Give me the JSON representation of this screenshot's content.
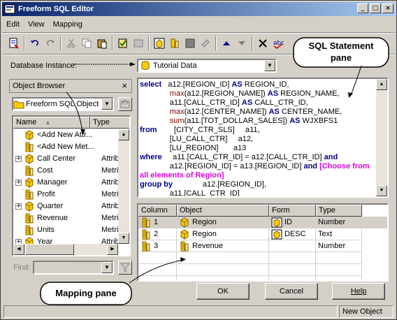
{
  "window": {
    "title": "Freeform SQL Editor",
    "minimize_glyph": "_",
    "maximize_glyph": "□",
    "close_glyph": "×"
  },
  "menu": [
    "Edit",
    "View",
    "Mapping"
  ],
  "toolbar_icons": [
    "sql-icon",
    "undo-icon",
    "redo-icon",
    "cut-icon",
    "copy-icon",
    "paste-icon",
    "validate-icon",
    "parse-icon",
    "attribute-icon",
    "metric-icon",
    "map-icon",
    "link-icon",
    "move-up-icon",
    "move-down-icon",
    "delete-icon",
    "spell-check-icon"
  ],
  "database_instance": {
    "label": "Database Instance:",
    "value": "Tutorial Data"
  },
  "object_browser": {
    "title": "Object Browser",
    "close_glyph": "×",
    "folder": "Freeform SQL Object",
    "columns": {
      "name": "Name",
      "type": "Type"
    },
    "rows": [
      {
        "name": "<Add New Attr...",
        "type": "",
        "icon": "attribute",
        "expand": false
      },
      {
        "name": "<Add New Met...",
        "type": "",
        "icon": "metric",
        "expand": false
      },
      {
        "name": "Call Center",
        "type": "Attribute",
        "icon": "attribute",
        "expand": true
      },
      {
        "name": "Cost",
        "type": "Metric",
        "icon": "metric",
        "expand": false
      },
      {
        "name": "Manager",
        "type": "Attribute",
        "icon": "attribute",
        "expand": true
      },
      {
        "name": "Profit",
        "type": "Metric",
        "icon": "metric",
        "expand": false
      },
      {
        "name": "Quarter",
        "type": "Attribute",
        "icon": "attribute",
        "expand": true
      },
      {
        "name": "Revenue",
        "type": "Metric",
        "icon": "metric",
        "expand": false
      },
      {
        "name": "Units",
        "type": "Metric",
        "icon": "metric",
        "expand": false
      },
      {
        "name": "Year",
        "type": "Attribute",
        "icon": "attribute",
        "expand": true
      }
    ],
    "find_label": "Find:"
  },
  "sql": [
    [
      {
        "c": "kw",
        "t": "select"
      },
      {
        "c": "",
        "t": "   a12.[REGION_ID] "
      },
      {
        "c": "kw",
        "t": "AS"
      },
      {
        "c": "",
        "t": " REGION_ID,"
      }
    ],
    [
      {
        "c": "",
        "t": "              "
      },
      {
        "c": "br",
        "t": "max"
      },
      {
        "c": "",
        "t": "(a12.[REGION_NAME]) "
      },
      {
        "c": "kw",
        "t": "AS"
      },
      {
        "c": "",
        "t": " REGION_NAME,"
      }
    ],
    [
      {
        "c": "",
        "t": "              a11.[CALL_CTR_ID] "
      },
      {
        "c": "kw",
        "t": "AS"
      },
      {
        "c": "",
        "t": " CALL_CTR_ID,"
      }
    ],
    [
      {
        "c": "",
        "t": "              "
      },
      {
        "c": "br",
        "t": "max"
      },
      {
        "c": "",
        "t": "(a12.[CENTER_NAME]) "
      },
      {
        "c": "kw",
        "t": "AS"
      },
      {
        "c": "",
        "t": " CENTER_NAME,"
      }
    ],
    [
      {
        "c": "",
        "t": "              "
      },
      {
        "c": "br",
        "t": "sum"
      },
      {
        "c": "",
        "t": "(a11.[TOT_DOLLAR_SALES]) "
      },
      {
        "c": "kw",
        "t": "AS"
      },
      {
        "c": "",
        "t": " WJXBFS1"
      }
    ],
    [
      {
        "c": "kw",
        "t": "from"
      },
      {
        "c": "",
        "t": "        [CITY_CTR_SLS]     a11,"
      }
    ],
    [
      {
        "c": "",
        "t": "              [LU_CALL_CTR]     a12,"
      }
    ],
    [
      {
        "c": "",
        "t": "              [LU_REGION]       a13"
      }
    ],
    [
      {
        "c": "kw",
        "t": "where"
      },
      {
        "c": "",
        "t": "     a11.[CALL_CTR_ID] = a12.[CALL_CTR_ID] "
      },
      {
        "c": "kw",
        "t": "and"
      }
    ],
    [
      {
        "c": "",
        "t": "              a12.[REGION_ID] = a13.[REGION_ID] "
      },
      {
        "c": "kw",
        "t": "and"
      },
      {
        "c": "",
        "t": " "
      },
      {
        "c": "pk",
        "t": "[Choose from"
      }
    ],
    [
      {
        "c": "pk",
        "t": "all elements of Region]"
      }
    ],
    [
      {
        "c": "kw",
        "t": "group by"
      },
      {
        "c": "",
        "t": "              a12.[REGION_ID],"
      }
    ],
    [
      {
        "c": "",
        "t": "              a11.[CALL_CTR_ID]"
      }
    ]
  ],
  "mapping": {
    "columns": [
      "Column",
      "Object",
      "Form",
      "Type"
    ],
    "rows": [
      {
        "column": "1",
        "object": "Region",
        "object_icon": "attribute",
        "form": "ID",
        "form_icon": "form",
        "type": "Number",
        "selected": true
      },
      {
        "column": "2",
        "object": "Region",
        "object_icon": "attribute",
        "form": "DESC",
        "form_icon": "form",
        "type": "Text",
        "selected": false
      },
      {
        "column": "3",
        "object": "Revenue",
        "object_icon": "metric",
        "form": "",
        "form_icon": "",
        "type": "Number",
        "selected": false
      }
    ]
  },
  "buttons": {
    "ok": "OK",
    "cancel": "Cancel",
    "help": "Help"
  },
  "status": {
    "right": "New Object"
  },
  "callouts": {
    "sql": "SQL Statement pane",
    "sql_line1": "SQL Statement",
    "sql_line2": "pane",
    "mapping": "Mapping pane"
  },
  "colors": {
    "keyword": "#00008b",
    "prompt": "#e000e0",
    "function": "#800000",
    "titlebar": "#0a246a",
    "selection": "#d4d0c8"
  }
}
